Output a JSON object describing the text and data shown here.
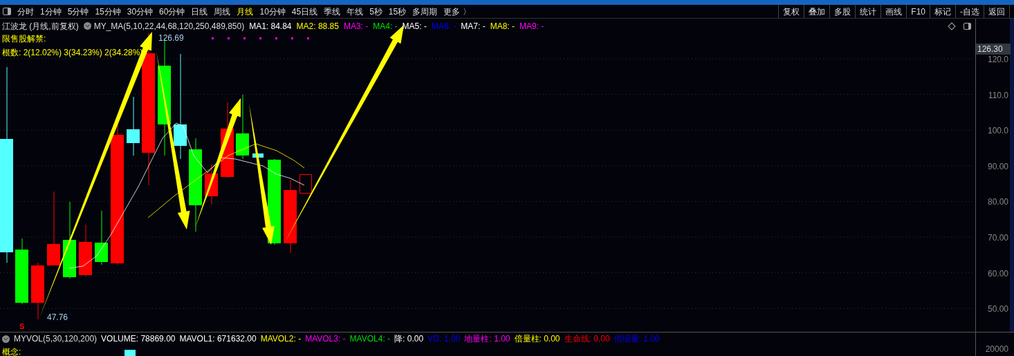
{
  "toolbar": {
    "periods": [
      {
        "label": "分时",
        "selected": false
      },
      {
        "label": "1分钟",
        "selected": false
      },
      {
        "label": "5分钟",
        "selected": false
      },
      {
        "label": "15分钟",
        "selected": false
      },
      {
        "label": "30分钟",
        "selected": false
      },
      {
        "label": "60分钟",
        "selected": false
      },
      {
        "label": "日线",
        "selected": false
      },
      {
        "label": "周线",
        "selected": false
      },
      {
        "label": "月线",
        "selected": true
      },
      {
        "label": "10分钟",
        "selected": false
      },
      {
        "label": "45日线",
        "selected": false
      },
      {
        "label": "季线",
        "selected": false
      },
      {
        "label": "年线",
        "selected": false
      },
      {
        "label": "5秒",
        "selected": false
      },
      {
        "label": "15秒",
        "selected": false
      },
      {
        "label": "多周期",
        "selected": false
      },
      {
        "label": "更多 〉",
        "selected": false
      }
    ],
    "actions": [
      "复权",
      "叠加",
      "多股",
      "统计",
      "画线",
      "F10",
      "标记",
      "-自选",
      "返回"
    ]
  },
  "price_legend": {
    "stock": "江波龙 (月线,前复权)",
    "indicator": "MY_MA(5,10,22,44,68,120,250,489,850)",
    "items": [
      {
        "label": "MA1: 84.84",
        "color": "#ffffff"
      },
      {
        "label": "MA2: 88.85",
        "color": "#ffff00"
      },
      {
        "label": "MA3: -",
        "color": "#ff00ff"
      },
      {
        "label": "MA4: -",
        "color": "#00e000"
      },
      {
        "label": "MA5: -",
        "color": "#ffffff"
      },
      {
        "label": "MA6: -",
        "color": "#0000ff"
      },
      {
        "label": "MA7: -",
        "color": "#ffffff"
      },
      {
        "label": "MA8: -",
        "color": "#ffff00"
      },
      {
        "label": "MA9: -",
        "color": "#ff00ff"
      }
    ]
  },
  "notes": [
    "限售股解禁:",
    "根数: 2(12.02%) 3(34.23%) 2(34.28%)"
  ],
  "chart": {
    "high_label": "126.69",
    "low_label": "47.76",
    "signal": "S",
    "current_price": "126.30",
    "yticks": [
      "120.0",
      "110.0",
      "100.0",
      "90.00",
      "80.00",
      "70.00",
      "60.00",
      "50.00"
    ]
  },
  "volume_legend": {
    "indicator": "MYVOL(5,30,120,200)",
    "items": [
      {
        "label": "VOLUME: 78869.00",
        "color": "#ffffff"
      },
      {
        "label": "MAVOL1: 671632.00",
        "color": "#ffffff"
      },
      {
        "label": "MAVOL2: -",
        "color": "#ffff00"
      },
      {
        "label": "MAVOL3: -",
        "color": "#ff00ff"
      },
      {
        "label": "MAVOL4: -",
        "color": "#00e000"
      },
      {
        "label": "降: 0.00",
        "color": "#ffffff"
      },
      {
        "label": "VO: 1.00",
        "color": "#0000ff"
      },
      {
        "label": "地量柱: 1.00",
        "color": "#ff00ff"
      },
      {
        "label": "倍量柱: 0.00",
        "color": "#ffff00"
      },
      {
        "label": "生命线: 0.00",
        "color": "#ff0000"
      },
      {
        "label": "倍缩量: 1.00",
        "color": "#0000ff"
      }
    ],
    "ytick": "20000",
    "concept": "概念:"
  }
}
